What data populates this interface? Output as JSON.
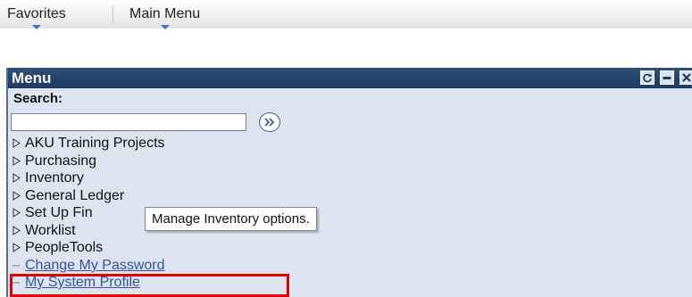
{
  "topbar": {
    "favorites_label": "Favorites",
    "main_menu_label": "Main Menu"
  },
  "menu": {
    "title": "Menu",
    "header_icons": [
      "refresh-icon",
      "minimize-icon",
      "close-icon"
    ],
    "search_label": "Search:",
    "search_value": "",
    "search_go_icon": "double-chevron-right-icon",
    "items": [
      {
        "label": "AKU Training Projects",
        "type": "folder"
      },
      {
        "label": "Purchasing",
        "type": "folder"
      },
      {
        "label": "Inventory",
        "type": "folder"
      },
      {
        "label": "General Ledger",
        "type": "folder"
      },
      {
        "label": "Set Up Fin",
        "type": "folder"
      },
      {
        "label": "Worklist",
        "type": "folder"
      },
      {
        "label": "PeopleTools",
        "type": "folder"
      },
      {
        "label": "Change My Password",
        "type": "link"
      },
      {
        "label": "My System Profile",
        "type": "link"
      }
    ]
  },
  "tooltip": {
    "text": "Manage Inventory options."
  },
  "colors": {
    "header_bg": "#1d3a62",
    "panel_bg": "#dde4ef",
    "link": "#3354a0",
    "highlight": "#e00000"
  }
}
